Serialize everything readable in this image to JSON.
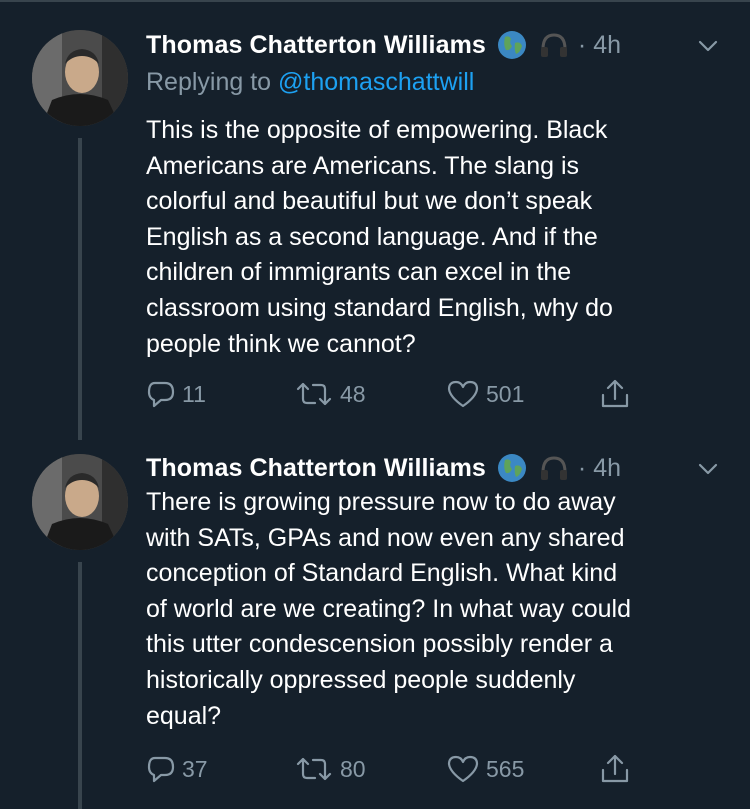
{
  "tweets": [
    {
      "author_name": "Thomas Chatterton Williams",
      "emoji_1": "globe-earth-emoji",
      "emoji_2": "headphones-emoji",
      "time": "· 4h",
      "replying_prefix": "Replying to",
      "replying_handle": "@thomaschattwill",
      "text": "This is the opposite of empowering. Black\nAmericans are Americans. The slang is\ncolorful and beautiful but we don’t speak\nEnglish as a second language. And if the\nchildren of immigrants can excel in the\nclassroom using standard English, why do\npeople think we cannot?",
      "replies": "11",
      "retweets": "48",
      "likes": "501"
    },
    {
      "author_name": "Thomas Chatterton Williams",
      "emoji_1": "globe-earth-emoji",
      "emoji_2": "headphones-emoji",
      "time": "· 4h",
      "text": "There is growing pressure now to do away\nwith SATs, GPAs and now even any shared\nconception of Standard English. What kind\nof world are we creating? In what way could\nthis utter condescension possibly render a\nhistorically oppressed people suddenly\nequal?",
      "replies": "37",
      "retweets": "80",
      "likes": "565"
    }
  ],
  "icons": {
    "reply": "reply-icon",
    "retweet": "retweet-icon",
    "like": "heart-icon",
    "share": "share-icon",
    "menu": "chevron-down-icon"
  },
  "colors": {
    "background": "#15202b",
    "text": "#ffffff",
    "muted": "#8899a6",
    "link": "#1da1f2",
    "divider": "#38444d"
  }
}
